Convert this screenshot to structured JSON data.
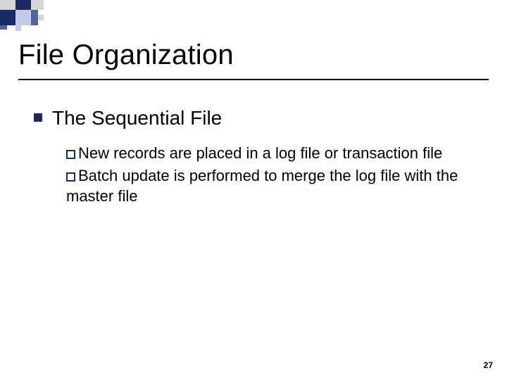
{
  "slide": {
    "title": "File Organization",
    "page_number": "27",
    "level1": {
      "text": "The Sequential File"
    },
    "level2": [
      {
        "text": "New records are placed in a log file or transaction file"
      },
      {
        "text": "Batch update is performed to merge the log file with the master file"
      }
    ]
  },
  "theme": {
    "accent_dark": "#1b2a63",
    "accent_mid": "#53619f",
    "accent_light": "#c6cbe3",
    "gray": "#d6d6d6"
  }
}
